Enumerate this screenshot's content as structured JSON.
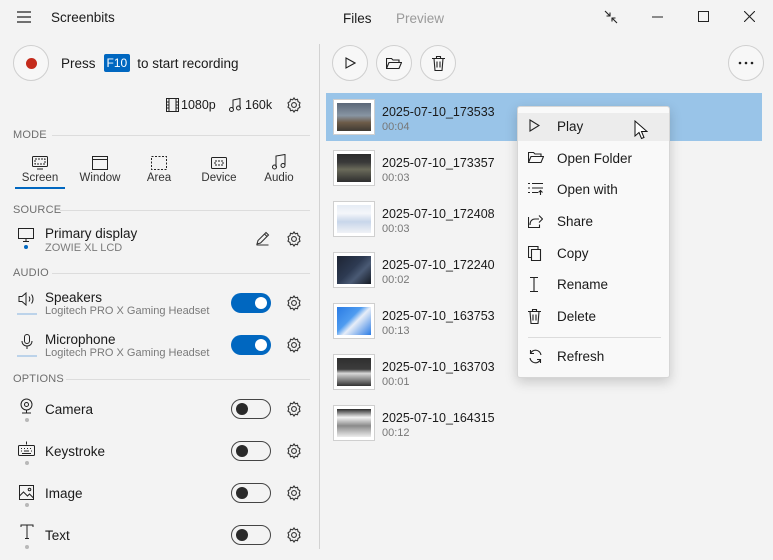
{
  "window": {
    "app_title": "Screenbits",
    "tabs": [
      {
        "label": "Files",
        "active": true
      },
      {
        "label": "Preview",
        "active": false
      }
    ]
  },
  "record": {
    "press_label": "Press",
    "key": "F10",
    "suffix": "to start recording",
    "resolution": "1080p",
    "bitrate": "160k"
  },
  "sections": {
    "mode": "MODE",
    "source": "SOURCE",
    "audio": "AUDIO",
    "options": "OPTIONS"
  },
  "modes": [
    {
      "label": "Screen",
      "icon": "screen-icon",
      "selected": true
    },
    {
      "label": "Window",
      "icon": "window-icon",
      "selected": false
    },
    {
      "label": "Area",
      "icon": "area-icon",
      "selected": false
    },
    {
      "label": "Device",
      "icon": "device-icon",
      "selected": false
    },
    {
      "label": "Audio",
      "icon": "audio-icon",
      "selected": false
    }
  ],
  "source": {
    "title": "Primary display",
    "subtitle": "ZOWIE XL LCD"
  },
  "audio": {
    "speakers": {
      "title": "Speakers",
      "subtitle": "Logitech PRO X Gaming Headset",
      "enabled": true
    },
    "microphone": {
      "title": "Microphone",
      "subtitle": "Logitech PRO X Gaming Headset",
      "enabled": true
    }
  },
  "options": [
    {
      "label": "Camera",
      "icon": "camera-icon",
      "enabled": false
    },
    {
      "label": "Keystroke",
      "icon": "keyboard-icon",
      "enabled": false
    },
    {
      "label": "Image",
      "icon": "image-icon",
      "enabled": false
    },
    {
      "label": "Text",
      "icon": "text-icon",
      "enabled": false
    }
  ],
  "files": [
    {
      "name": "2025-07-10_173533",
      "duration": "00:04",
      "selected": true
    },
    {
      "name": "2025-07-10_173357",
      "duration": "00:03",
      "selected": false
    },
    {
      "name": "2025-07-10_172408",
      "duration": "00:03",
      "selected": false
    },
    {
      "name": "2025-07-10_172240",
      "duration": "00:02",
      "selected": false
    },
    {
      "name": "2025-07-10_163753",
      "duration": "00:13",
      "selected": false
    },
    {
      "name": "2025-07-10_163703",
      "duration": "00:01",
      "selected": false
    },
    {
      "name": "2025-07-10_164315",
      "duration": "00:12",
      "selected": false
    }
  ],
  "context_menu": {
    "items": [
      {
        "label": "Play",
        "icon": "play-icon"
      },
      {
        "label": "Open Folder",
        "icon": "folder-icon"
      },
      {
        "label": "Open with",
        "icon": "open-with-icon"
      },
      {
        "label": "Share",
        "icon": "share-icon"
      },
      {
        "label": "Copy",
        "icon": "copy-icon"
      },
      {
        "label": "Rename",
        "icon": "rename-icon"
      },
      {
        "label": "Delete",
        "icon": "delete-icon"
      }
    ],
    "refresh": {
      "label": "Refresh",
      "icon": "refresh-icon"
    }
  },
  "colors": {
    "accent": "#0067c0",
    "selection": "#99c4e8",
    "record_dot": "#c42b1c"
  }
}
